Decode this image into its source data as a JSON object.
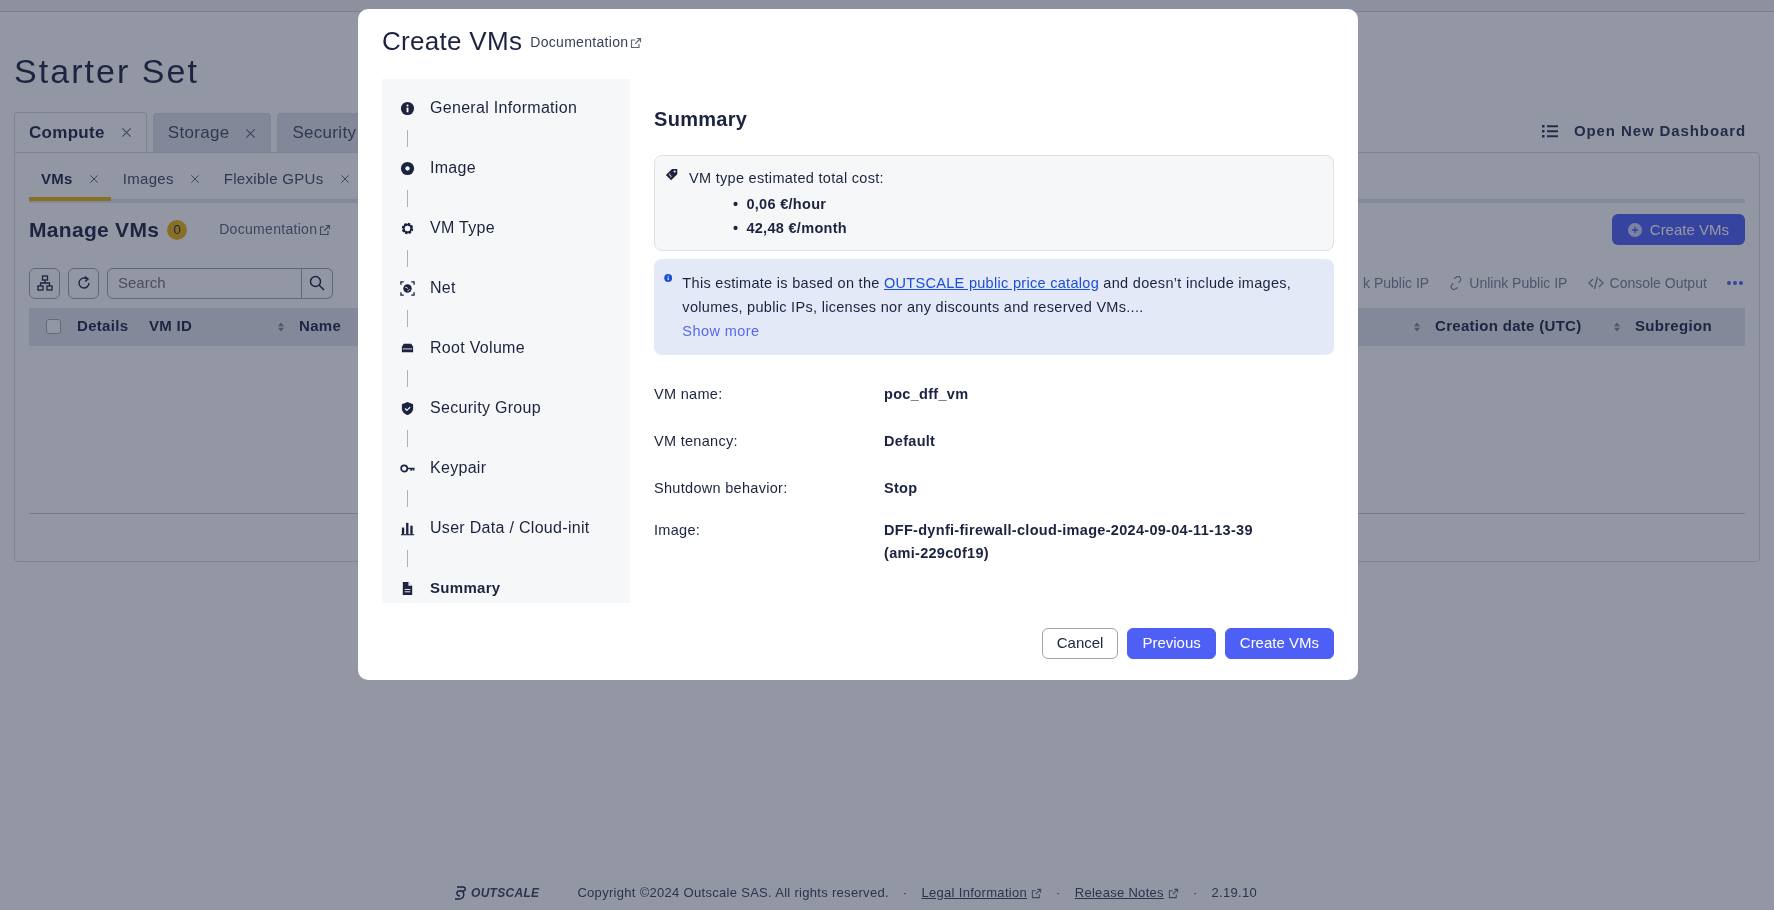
{
  "page": {
    "title": "Starter Set"
  },
  "top_tabs": [
    {
      "label": "Compute",
      "selected": true,
      "closable": true
    },
    {
      "label": "Storage",
      "selected": false,
      "closable": true
    },
    {
      "label": "Security",
      "selected": false,
      "closable": false
    }
  ],
  "dashboard_button": "Open New Dashboard",
  "sub_tabs": [
    {
      "label": "VMs",
      "selected": true
    },
    {
      "label": "Images",
      "selected": false
    },
    {
      "label": "Flexible GPUs",
      "selected": false
    }
  ],
  "section": {
    "title": "Manage VMs",
    "count": "0",
    "doc_link": "Documentation",
    "create_button": "Create VMs"
  },
  "search": {
    "placeholder": "Search"
  },
  "actions": [
    {
      "kind": "plain",
      "label": "k Public IP"
    },
    {
      "kind": "unlink",
      "label": "Unlink Public IP"
    },
    {
      "kind": "code",
      "label": "Console Output"
    },
    {
      "kind": "more"
    }
  ],
  "table": {
    "select_all": {
      "checked": false
    },
    "columns": [
      {
        "label": "Details",
        "sortable": false
      },
      {
        "label": "VM ID",
        "sortable": true
      },
      {
        "label": "Name",
        "sortable": false
      },
      {
        "sortable": true
      },
      {
        "label": "Creation date (UTC)",
        "sortable": true
      },
      {
        "label": "Subregion",
        "sortable": false
      }
    ]
  },
  "modal": {
    "title": "Create VMs",
    "doc_link": "Documentation",
    "steps": [
      {
        "label": "General Information",
        "selected": false
      },
      {
        "label": "Image",
        "selected": false
      },
      {
        "label": "VM Type",
        "selected": false
      },
      {
        "label": "Net",
        "selected": false
      },
      {
        "label": "Root Volume",
        "selected": false
      },
      {
        "label": "Security Group",
        "selected": false
      },
      {
        "label": "Keypair",
        "selected": false
      },
      {
        "label": "User Data / Cloud-init",
        "selected": false
      },
      {
        "label": "Summary",
        "selected": true
      }
    ],
    "heading": "Summary",
    "cost": {
      "label": "VM type estimated total cost:",
      "bullet": "•",
      "items": [
        "0,06 €/hour",
        "42,48 €/month"
      ]
    },
    "notice": {
      "before": "This estimate is based on the ",
      "link": "OUTSCALE public price catalog",
      "after": " and doesn’t include images, volumes, public IPs, licenses nor any discounts and reserved VMs....",
      "more": "Show more"
    },
    "fields": [
      {
        "label": "VM name:",
        "value": "poc_dff_vm"
      },
      {
        "label": "VM tenancy:",
        "value": "Default"
      },
      {
        "label": "Shutdown behavior:",
        "value": "Stop"
      },
      {
        "label": "Image:",
        "value": "DFF-dynfi-firewall-cloud-image-2024-09-04-11-13-39 (ami-229c0f19)"
      }
    ],
    "buttons": [
      {
        "kind": "secondary",
        "label": "Cancel"
      },
      {
        "kind": "primary",
        "label": "Previous"
      },
      {
        "kind": "primary",
        "label": "Create VMs"
      }
    ]
  },
  "footer": {
    "logo": "OUTSCALE",
    "items": [
      {
        "kind": "text",
        "text": "Copyright ©2024 Outscale SAS. All rights reserved."
      },
      {
        "kind": "sep",
        "text": "·"
      },
      {
        "kind": "link",
        "text": "Legal Information"
      },
      {
        "kind": "sep",
        "text": "·"
      },
      {
        "kind": "link",
        "text": "Release Notes"
      },
      {
        "kind": "sep",
        "text": "·"
      },
      {
        "kind": "text",
        "text": "2.19.10"
      }
    ]
  }
}
